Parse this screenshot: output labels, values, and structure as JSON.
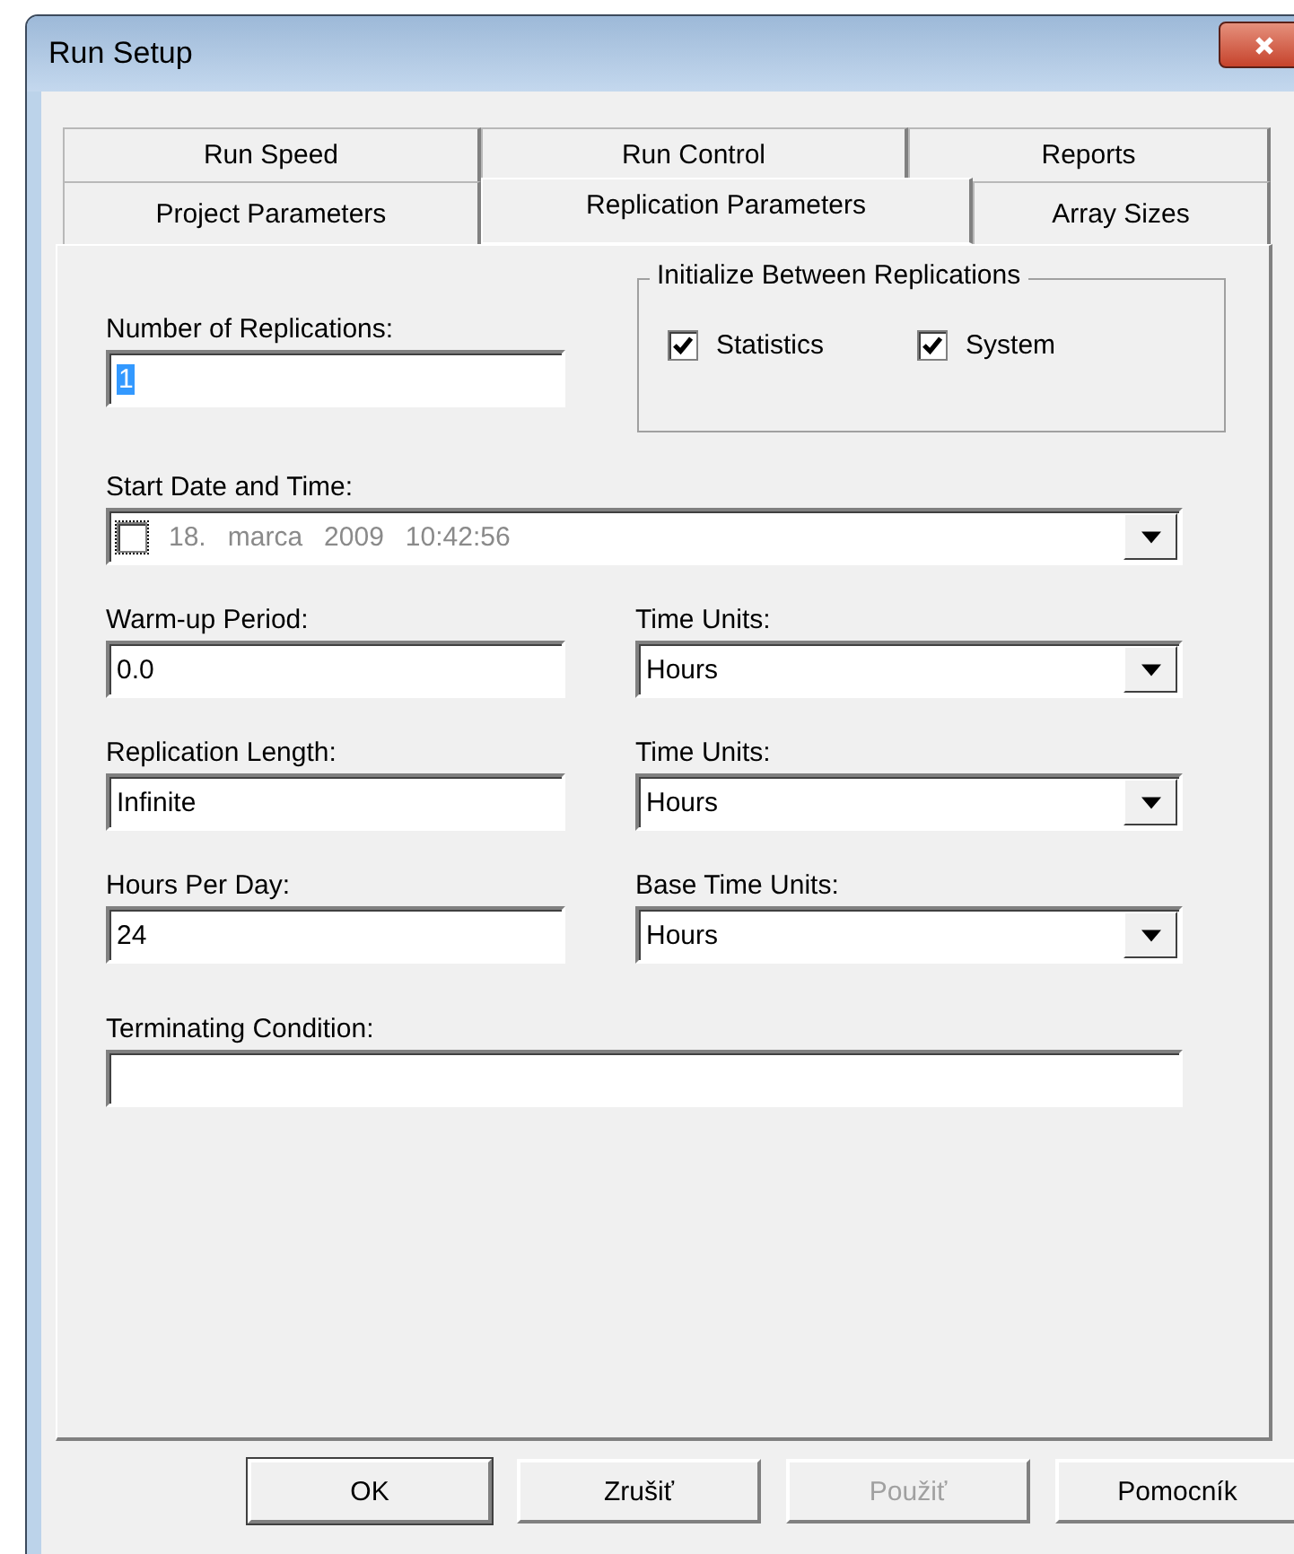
{
  "window": {
    "title": "Run Setup"
  },
  "tab_rows": [
    [
      {
        "label": "Run Speed",
        "selected": false
      },
      {
        "label": "Run Control",
        "selected": false
      },
      {
        "label": "Reports",
        "selected": false
      }
    ],
    [
      {
        "label": "Project Parameters",
        "selected": false
      },
      {
        "label": "Replication Parameters",
        "selected": true
      },
      {
        "label": "Array Sizes",
        "selected": false
      }
    ]
  ],
  "replications": {
    "label": "Number of Replications:",
    "value": "1",
    "selected": true
  },
  "initialize": {
    "title": "Initialize Between Replications",
    "options": [
      {
        "label": "Statistics",
        "checked": true
      },
      {
        "label": "System",
        "checked": true
      }
    ]
  },
  "start_date": {
    "label": "Start Date and Time:",
    "checked": false,
    "parts": [
      "18.",
      "marca",
      "2009",
      "10:42:56"
    ]
  },
  "rows": [
    {
      "field": {
        "label": "Warm-up Period:",
        "value": "0.0"
      },
      "units": {
        "label": "Time Units:",
        "value": "Hours"
      }
    },
    {
      "field": {
        "label": "Replication Length:",
        "value": "Infinite"
      },
      "units": {
        "label": "Time Units:",
        "value": "Hours"
      }
    },
    {
      "field": {
        "label": "Hours Per Day:",
        "value": "24"
      },
      "units": {
        "label": "Base Time Units:",
        "value": "Hours"
      }
    }
  ],
  "terminating": {
    "label": "Terminating Condition:"
  },
  "buttons": [
    {
      "label": "OK",
      "default": true,
      "disabled": false
    },
    {
      "label": "Zrušiť",
      "default": false,
      "disabled": false
    },
    {
      "label": "Použiť",
      "default": false,
      "disabled": true
    },
    {
      "label": "Pomocník",
      "default": false,
      "disabled": false
    }
  ]
}
